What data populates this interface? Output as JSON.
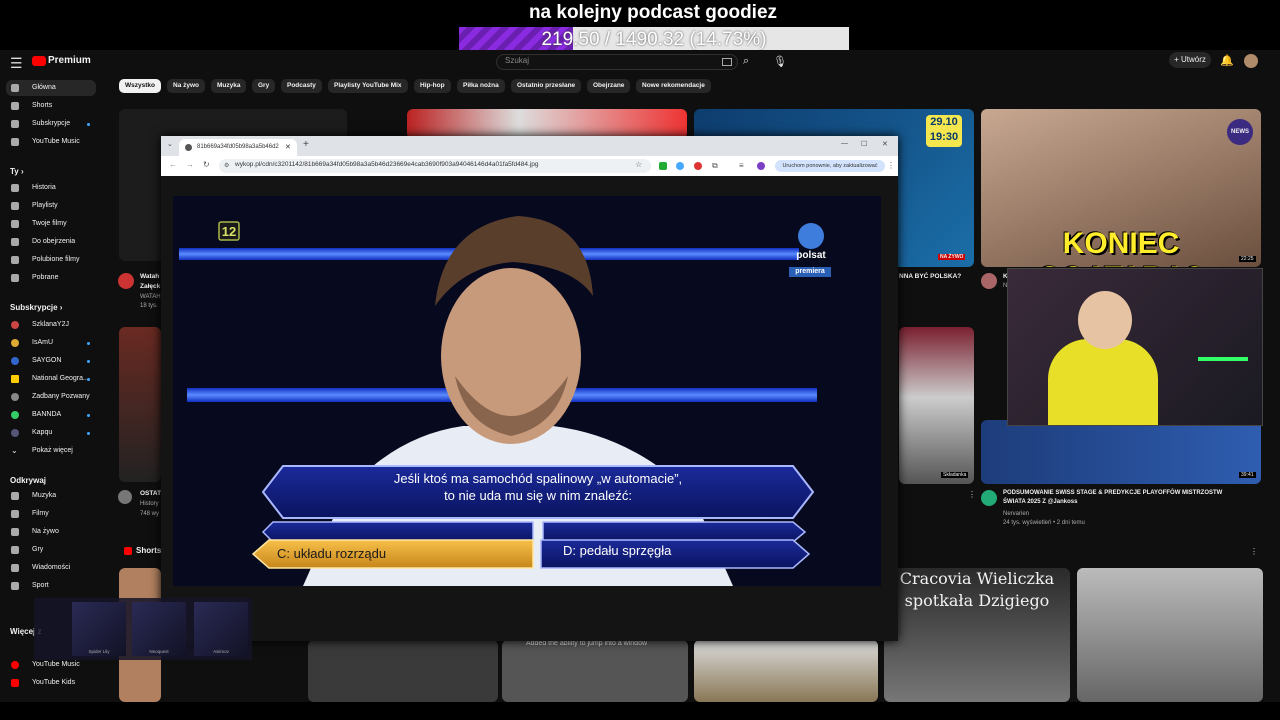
{
  "stream": {
    "goal_title": "na kolejny podcast goodiez",
    "goal_progress": "219.50 / 1490.32 (14.73%)",
    "goal_fraction": 0.1473,
    "bar_color": "#8a2be2"
  },
  "header": {
    "logo_text": "Premium",
    "search_placeholder": "Szukaj",
    "create_label": "Utwórz"
  },
  "chips": [
    "Wszystko",
    "Na żywo",
    "Muzyka",
    "Gry",
    "Podcasty",
    "Playlisty YouTube Mix",
    "Hip-hop",
    "Piłka nożna",
    "Ostatnio przesłane",
    "Obejrzane",
    "Nowe rekomendacje"
  ],
  "sidebar": {
    "main": [
      "Główna",
      "Shorts",
      "Subskrypcje",
      "YouTube Music"
    ],
    "you_header": "Ty",
    "you": [
      "Historia",
      "Playlisty",
      "Twoje filmy",
      "Do obejrzenia",
      "Polubione filmy",
      "Pobrane"
    ],
    "subs_header": "Subskrypcje",
    "subs": [
      "SzklanaY2J",
      "IsAmU",
      "SAYGON",
      "National Geogra...",
      "Zadbany Pozwany",
      "BANNDA",
      "Kapqu",
      "Pokaż więcej"
    ],
    "explore_header": "Odkrywaj",
    "explore": [
      "Muzyka",
      "Filmy",
      "Na żywo",
      "Gry",
      "Wiadomości",
      "Sport"
    ],
    "more_header": "Więcej z",
    "more": [
      "YouTube Music",
      "YouTube Kids"
    ]
  },
  "videos": {
    "left_title_1": "Watah",
    "left_title_2": "Załęck",
    "left_meta_1": "WATAH",
    "left_meta_2": "18 tys.",
    "left2_title": "OSTAT",
    "left2_meta_1": "History",
    "left2_meta_2": "748 wy",
    "mid_title": "NNA BYĆ POLSKA?",
    "date_badge_1": "29.10",
    "date_badge_2": "19:30",
    "live_badge": "NA ŻYWO",
    "goat_title": "KONIEC GOATARA?",
    "goat_duration": "22:25",
    "news_badge": "NEWS",
    "k_letter": "K",
    "n_letter": "N",
    "skladanka": "Składanka",
    "swiss_duration": "39:41",
    "swiss_title_1": "PODSUMOWANIE SWISS STAGE & PREDYKCJE PLAYOFFÓW MISTRZOSTW",
    "swiss_title_2": "ŚWIATA 2025 Z @Jankoss",
    "swiss_channel": "Nervarien",
    "swiss_meta": "24 tys. wyświetleń • 2 dni temu",
    "shorts_label": "Shorts",
    "cracovia_1": "Cracovia Wieliczka",
    "cracovia_2": "spotkała Dzigiego",
    "patch_note": "Added the ability to jump into a window"
  },
  "browser": {
    "tab_title": "81b669a34fd05b98a3a5b46d2",
    "url": "wykop.pl/cdn/c3201142/81b669a34fd05b98a3a5b46d23669e4cab3690f903a94046146d4a01fa5fd484.jpg",
    "update_label": "Uruchom ponownie, aby zaktualizować"
  },
  "tv": {
    "channel_rating": "12",
    "channel_name": "polsat",
    "channel_tag": "premiera",
    "question_line1": "Jeśli ktoś ma samochód spalinowy „w automacie”,",
    "question_line2": "to nie uda mu się w nim znaleźć:",
    "answer_c": "C: układu rozrządu",
    "answer_d": "D: pedału sprzęgła"
  },
  "skins": [
    "Spider Lily",
    "Neoquest",
    "Asiimov"
  ]
}
